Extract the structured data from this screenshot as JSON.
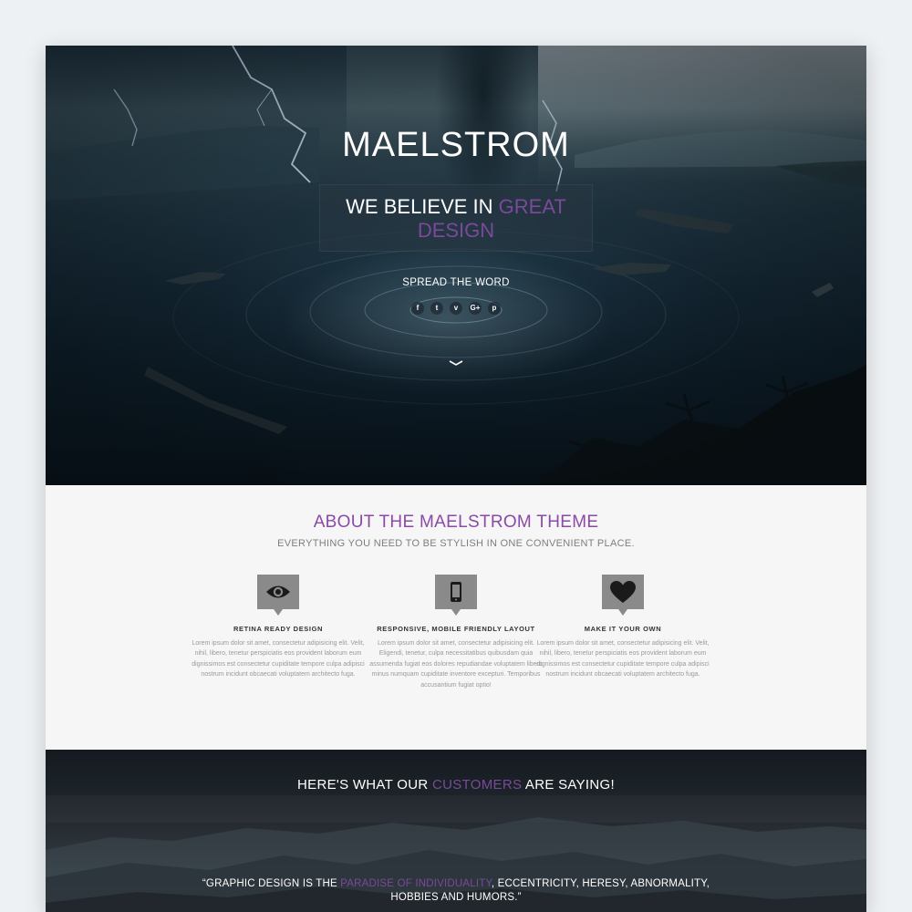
{
  "hero": {
    "title": "MAELSTROM",
    "tagline_before": "WE BELIEVE IN ",
    "tagline_accent": "GREAT DESIGN",
    "spread_label": "SPREAD THE WORD",
    "socials": [
      {
        "icon": "facebook-icon",
        "glyph": "f"
      },
      {
        "icon": "twitter-icon",
        "glyph": "t"
      },
      {
        "icon": "vimeo-icon",
        "glyph": "v"
      },
      {
        "icon": "google-plus-icon",
        "glyph": "G+"
      },
      {
        "icon": "pinterest-icon",
        "glyph": "p"
      }
    ],
    "scroll_icon": "chevron-down-icon"
  },
  "about": {
    "title": "ABOUT THE MAELSTROM THEME",
    "subtitle": "EVERYTHING YOU NEED TO BE STYLISH IN ONE CONVENIENT PLACE.",
    "features": [
      {
        "icon": "eye-icon",
        "title": "RETINA READY DESIGN",
        "text": "Lorem ipsum dolor sit amet, consectetur adipisicing elit. Velit, nihil, libero, tenetur perspiciatis eos provident laborum eum dignissimos est consectetur cupiditate tempore culpa adipisci nostrum incidunt obcaecati voluptatem architecto fuga."
      },
      {
        "icon": "mobile-phone-icon",
        "title": "RESPONSIVE, MOBILE FRIENDLY LAYOUT",
        "text": "Lorem ipsum dolor sit amet, consectetur adipisicing elit. Eligendi, tenetur, culpa necessitatibus quibusdam quia assumenda fugiat eos dolores repudiandae voluptatem libero minus numquam cupiditate inventore excepturi. Temporibus accusantium fugiat optio!"
      },
      {
        "icon": "heart-icon",
        "title": "MAKE IT YOUR OWN",
        "text": "Lorem ipsum dolor sit amet, consectetur adipisicing elit. Velit, nihil, libero, tenetur perspiciatis eos provident laborum eum dignissimos est consectetur cupiditate tempore culpa adipisci nostrum incidunt obcaecati voluptatem architecto fuga."
      }
    ]
  },
  "testimonials": {
    "title_before": "HERE'S WHAT OUR ",
    "title_accent": "CUSTOMERS",
    "title_after": " ARE SAYING!",
    "quote_before": "“GRAPHIC DESIGN IS THE ",
    "quote_accent": "PARADISE OF INDIVIDUALITY",
    "quote_after": ", ECCENTRICITY, HERESY, ABNORMALITY, HOBBIES AND HUMORS.”"
  },
  "colors": {
    "accent": "#7a4a9a",
    "page_background": "#eef1f4",
    "about_background": "#f6f6f6",
    "icon_box": "#8a8a8a"
  }
}
